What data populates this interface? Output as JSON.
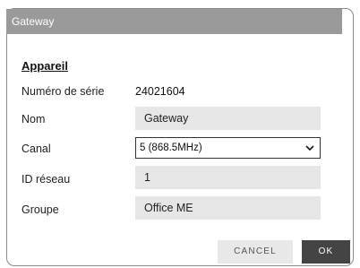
{
  "dialog": {
    "title": "Gateway",
    "section": "Appareil",
    "fields": [
      {
        "label": "Numéro de série",
        "value": "24021604"
      },
      {
        "label": "Nom",
        "value": "Gateway"
      },
      {
        "label": "Canal",
        "value": "5 (868.5MHz)"
      },
      {
        "label": "ID réseau",
        "value": "1"
      },
      {
        "label": "Groupe",
        "value": "Office ME"
      }
    ],
    "buttons": {
      "cancel": "CANCEL",
      "ok": "OK"
    }
  }
}
